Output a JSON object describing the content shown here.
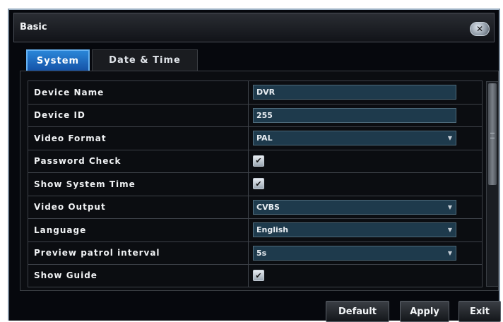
{
  "window": {
    "title": "Basic"
  },
  "tabs": [
    {
      "label": "System",
      "selected": true
    },
    {
      "label": "Date & Time",
      "selected": false
    }
  ],
  "settings": [
    {
      "label": "Device Name",
      "type": "text",
      "value": "DVR"
    },
    {
      "label": "Device ID",
      "type": "text",
      "value": "255"
    },
    {
      "label": "Video Format",
      "type": "select",
      "value": "PAL"
    },
    {
      "label": "Password Check",
      "type": "checkbox",
      "checked": true,
      "mark": "✔"
    },
    {
      "label": "Show System Time",
      "type": "checkbox",
      "checked": true,
      "mark": "✔"
    },
    {
      "label": "Video Output",
      "type": "select",
      "value": "CVBS"
    },
    {
      "label": "Language",
      "type": "select",
      "value": "English"
    },
    {
      "label": "Preview patrol interval",
      "type": "select",
      "value": "5s"
    },
    {
      "label": "Show Guide",
      "type": "checkbox",
      "checked": true,
      "mark": "✔"
    }
  ],
  "footer": {
    "default_label": "Default",
    "apply_label": "Apply",
    "exit_label": "Exit"
  },
  "icons": {
    "close": "close-icon",
    "dropdown": "chevron-down-icon",
    "check": "check-icon"
  },
  "colors": {
    "accent_tab": "#1f6fc4",
    "field_bg": "#1e3a4c",
    "window_bg": "#06080d"
  }
}
